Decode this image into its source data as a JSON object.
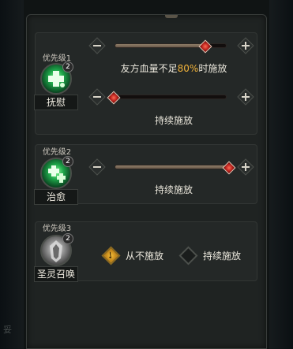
{
  "colors": {
    "highlight": "#f2b33a",
    "text": "#ece8dd",
    "panel": "#1f2322"
  },
  "background": {
    "bottom_hint": "妥"
  },
  "rules": [
    {
      "priority_label": "优先级1",
      "skill": {
        "name": "抚慰",
        "charges": "2",
        "icon": "green-cross-heal-icon"
      },
      "sliders": [
        {
          "value": 0.8,
          "decrease_icon": "minus-icon",
          "increase_icon": "plus-icon",
          "desc_prefix": "友方血量不足",
          "desc_highlight": "80%",
          "desc_suffix": "时施放"
        },
        {
          "value": 0.0,
          "decrease_icon": "minus-icon",
          "increase_icon": "plus-icon",
          "desc": "持续施放"
        }
      ]
    },
    {
      "priority_label": "优先级2",
      "skill": {
        "name": "治愈",
        "charges": "2",
        "icon": "green-cross-heal-icon"
      },
      "sliders": [
        {
          "value": 1.0,
          "decrease_icon": "minus-icon",
          "increase_icon": "plus-icon",
          "desc": "持续施放"
        }
      ]
    },
    {
      "priority_label": "优先级3",
      "skill": {
        "name": "圣灵召唤",
        "charges": "2",
        "icon": "spirit-summon-icon"
      },
      "options": [
        {
          "label": "从不施放",
          "checked": true
        },
        {
          "label": "持续施放",
          "checked": false
        }
      ]
    }
  ]
}
